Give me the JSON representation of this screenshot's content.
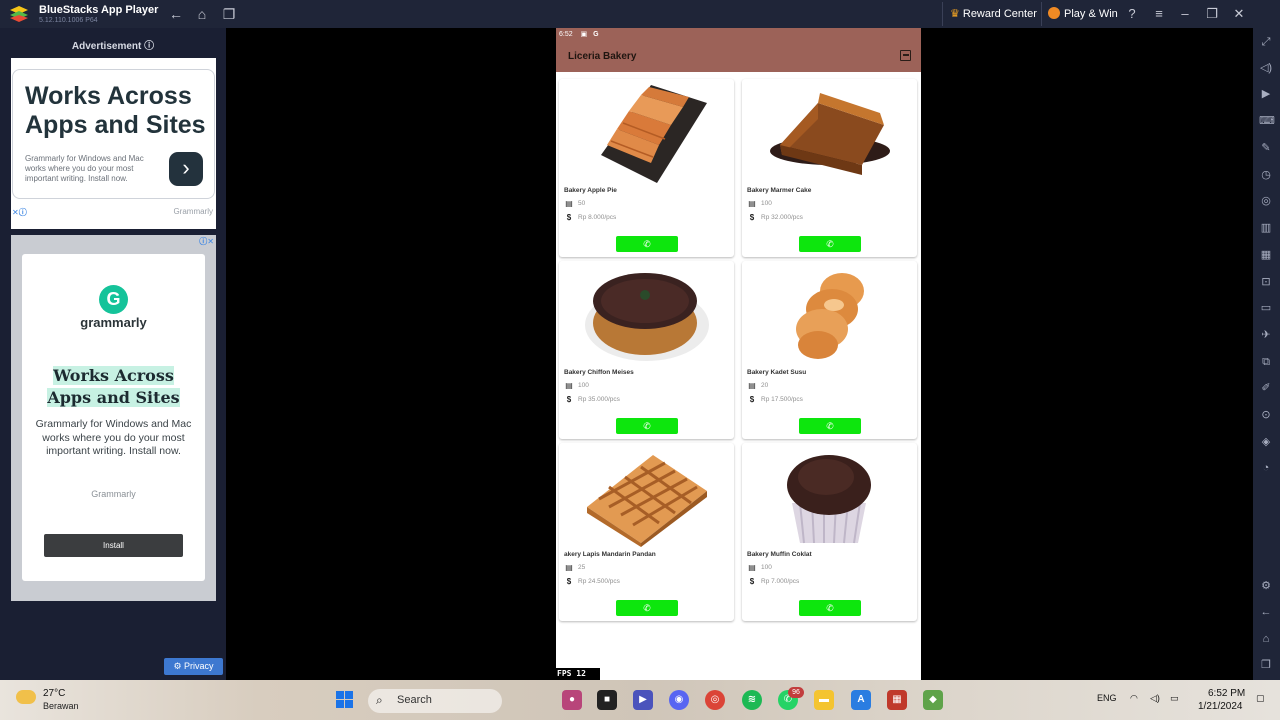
{
  "window": {
    "title": "BlueStacks App Player",
    "version": "5.12.110.1006  P64",
    "reward_center": "Reward Center",
    "play_win": "Play & Win"
  },
  "ads": {
    "header": "Advertisement ⓘ",
    "ad1": {
      "headline": "Works Across Apps and Sites",
      "body": "Grammarly for Windows and Mac works where you do your most important writing. Install now.",
      "brand": "Grammarly"
    },
    "ad2": {
      "logo": "G",
      "brand_name": "grammarly",
      "headline": "Works Across Apps and Sites",
      "body": "Grammarly for Windows and Mac works where you do your most important writing. Install now.",
      "brand": "Grammarly",
      "install": "Install"
    },
    "privacy": "Privacy"
  },
  "phone": {
    "status_time": "6:52",
    "app_title": "Liceria Bakery",
    "fps": "FPS  12",
    "products": [
      {
        "name": "Bakery Apple Pie",
        "stock": "50",
        "price": "Rp 8.000/pcs"
      },
      {
        "name": "Bakery Marmer Cake",
        "stock": "100",
        "price": "Rp 32.000/pcs"
      },
      {
        "name": "Bakery Chiffon Meises",
        "stock": "100",
        "price": "Rp 35.000/pcs"
      },
      {
        "name": "Bakery Kadet Susu",
        "stock": "20",
        "price": "Rp 17.500/pcs"
      },
      {
        "name": "akery Lapis Mandarin Pandan",
        "stock": "25",
        "price": "Rp 24.500/pcs"
      },
      {
        "name": "Bakery Muffin Coklat",
        "stock": "100",
        "price": "Rp 7.000/pcs"
      }
    ]
  },
  "taskbar": {
    "temperature": "27°C",
    "weather": "Berawan",
    "search": "Search",
    "badge": "96",
    "lang": "ENG",
    "time": "6:52 PM",
    "date": "1/21/2024"
  },
  "colors": {
    "appbar": "#9c6258",
    "call_button": "#0de60d",
    "bluestacks_chrome": "#1f2538"
  }
}
